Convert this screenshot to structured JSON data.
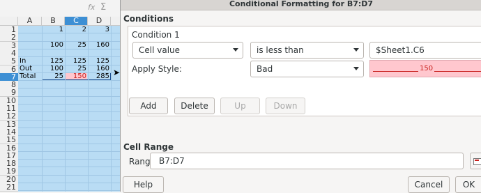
{
  "spreadsheet": {
    "toolbar": {
      "fx_icon": "fx",
      "sum_icon": "Σ"
    },
    "columns": [
      "A",
      "B",
      "C",
      "D"
    ],
    "selected_column": "C",
    "rows": [
      "1",
      "2",
      "3",
      "4",
      "5",
      "6",
      "7",
      "8",
      "9",
      "10",
      "11",
      "12",
      "13",
      "14",
      "15",
      "16",
      "17",
      "18",
      "19",
      "20",
      "21"
    ],
    "selected_row": "7",
    "cells": {
      "B1": "1",
      "C1": "2",
      "D1": "3",
      "B3": "100",
      "C3": "25",
      "D3": "160",
      "A5": "In",
      "B5": "125",
      "C5": "125",
      "D5": "125",
      "A6": "Out",
      "B6": "100",
      "C6": "25",
      "D6": "160",
      "A7": "Total",
      "B7": "25",
      "C7": "150",
      "D7": "285"
    },
    "colors": {
      "grid_bg": "#b9dcf4",
      "highlight": "#3d8fd4",
      "bad_fill": "#ffc7ce",
      "bad_text": "#c9211e"
    }
  },
  "dialog": {
    "title": "Conditional Formatting for B7:D7",
    "conditions_heading": "Conditions",
    "condition": {
      "label": "Condition 1",
      "type": "Cell value",
      "operator": "is less than",
      "value": "$Sheet1.C6",
      "apply_style_label": "Apply Style:",
      "style": "Bad",
      "preview_text": "150"
    },
    "buttons": {
      "add": "Add",
      "delete": "Delete",
      "up": "Up",
      "down": "Down"
    },
    "cell_range": {
      "heading": "Cell Range",
      "label": "Range:",
      "value": "B7:D7"
    },
    "footer": {
      "help": "Help",
      "cancel": "Cancel",
      "ok": "OK"
    }
  }
}
